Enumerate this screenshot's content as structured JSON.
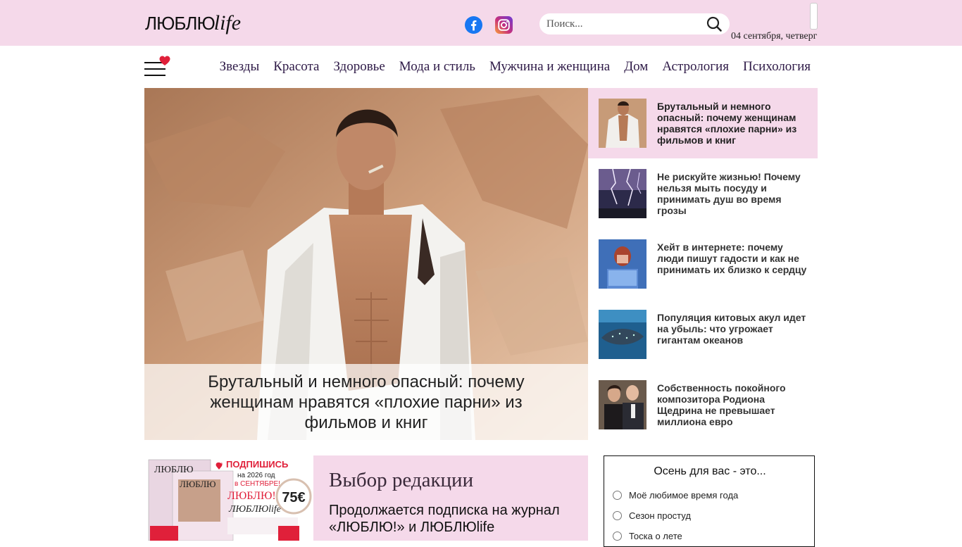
{
  "header": {
    "logo_main": "ЛЮБЛЮ",
    "logo_suffix": "life",
    "search_placeholder": "Поиск...",
    "date": "04 сентября, четверг"
  },
  "nav": {
    "items": [
      "Звезды",
      "Красота",
      "Здоровье",
      "Мода и стиль",
      "Мужчина и женщина",
      "Дом",
      "Астрология",
      "Психология"
    ]
  },
  "hero": {
    "title": "Брутальный и немного опасный: почему женщинам нравятся «плохие парни» из фильмов и книг"
  },
  "side_news": [
    {
      "title": "Брутальный и немного опасный: почему женщинам нравятся «плохие парни» из фильмов и книг",
      "icon": "man-photo"
    },
    {
      "title": "Не рискуйте жизнью! Почему нельзя мыть посуду и принимать душ во время грозы",
      "icon": "lightning-photo"
    },
    {
      "title": "Хейт в интернете: почему люди пишут гадости и как не принимать их близко к сердцу",
      "icon": "laptop-woman-photo"
    },
    {
      "title": "Популяция китовых акул идет на убыль: что угрожает гигантам океанов",
      "icon": "whale-shark-photo"
    },
    {
      "title": "Собственность покойного композитора Родиона Щедрина не превышает миллиона евро",
      "icon": "couple-photo"
    }
  ],
  "promo": {
    "heading": "Выбор редакции",
    "title": "Продолжается подписка на журнал «ЛЮБЛЮ!» и ЛЮБЛЮlife",
    "img_text_1": "ПОДПИШИСЬ",
    "img_text_2": "на 2026 год",
    "img_text_3": "в СЕНТЯБРЕ!",
    "img_price": "75€"
  },
  "poll": {
    "title": "Осень для вас - это...",
    "options": [
      "Моё любимое время года",
      "Сезон простуд",
      "Тоска о лете"
    ]
  },
  "colors": {
    "brand_pink": "#f5d9ea",
    "nav_text": "#2e1a47",
    "heart_red": "#e0203a"
  }
}
